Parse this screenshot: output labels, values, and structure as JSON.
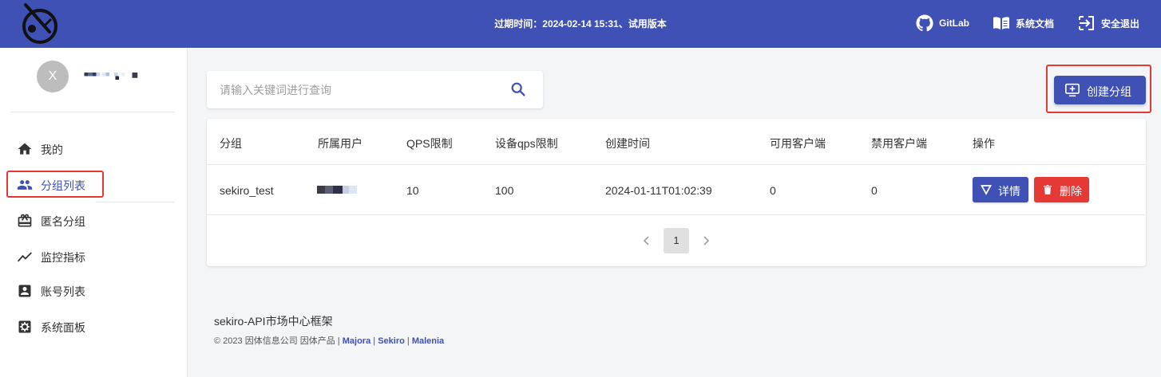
{
  "header": {
    "expire_text": "过期时间：2024-02-14 15:31、试用版本",
    "gitlab_label": "GitLab",
    "docs_label": "系统文档",
    "logout_label": "安全退出",
    "bg_color": "#3f51b5"
  },
  "user": {
    "avatar_letter": "X"
  },
  "sidebar": {
    "items": [
      {
        "label": "我的",
        "icon": "home-icon"
      },
      {
        "label": "分组列表",
        "icon": "group-icon",
        "active": true
      },
      {
        "label": "匿名分组",
        "icon": "card-giftcard-icon"
      },
      {
        "label": "监控指标",
        "icon": "trending-icon"
      },
      {
        "label": "账号列表",
        "icon": "account-box-icon"
      },
      {
        "label": "系统面板",
        "icon": "settings-panel-icon"
      }
    ]
  },
  "search": {
    "placeholder": "请输入关键词进行查询",
    "value": ""
  },
  "create_button_label": "创建分组",
  "table": {
    "headers": [
      "分组",
      "所属用户",
      "QPS限制",
      "设备qps限制",
      "创建时间",
      "可用客户端",
      "禁用客户端",
      "操作"
    ],
    "rows": [
      {
        "group": "sekiro_test",
        "qps": "10",
        "device_qps": "100",
        "created": "2024-01-11T01:02:39",
        "available": "0",
        "disabled": "0"
      }
    ],
    "detail_label": "详情",
    "delete_label": "删除"
  },
  "pagination": {
    "current": "1"
  },
  "footer": {
    "title": "sekiro-API市场中心框架",
    "copyright": "© 2023 因体信息公司  因体产品  |",
    "links": [
      "Majora",
      "Sekiro",
      "Malenia"
    ],
    "sep": "|"
  },
  "colors": {
    "primary": "#3f51b5",
    "danger": "#e53935",
    "highlight": "#e53935"
  }
}
